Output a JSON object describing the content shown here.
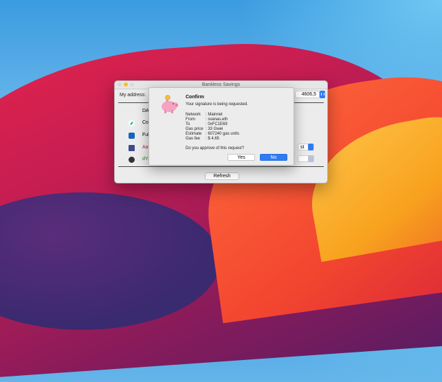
{
  "window": {
    "title": "Bankless Savings",
    "address_label": "My address:",
    "balance": "4606,5",
    "refresh_label": "Refresh"
  },
  "rows": [
    {
      "name": "DAI",
      "color": "#222222"
    },
    {
      "name": "Compound",
      "color": "#222222",
      "icon": "compound-icon"
    },
    {
      "name": "Fulcrum",
      "color": "#222222",
      "icon": "fulcrum-icon"
    },
    {
      "name": "Aave",
      "color": "#b0203f",
      "icon": "aave-icon"
    },
    {
      "name": "dYdX",
      "color": "#1f7d2a",
      "icon": "dydx-icon"
    }
  ],
  "select_visible": "st",
  "dialog": {
    "title": "Confirm",
    "message": "Your signature is being requested.",
    "details": [
      {
        "key": "Network",
        "value": ": Mainnet"
      },
      {
        "key": "From",
        "value": ": svanas.eth"
      },
      {
        "key": "To",
        "value": ": 0xFC1E69"
      },
      {
        "key": "Gas price",
        "value": ": 33 Gwei"
      },
      {
        "key": "Estimate",
        "value": ": 607240 gas units"
      },
      {
        "key": "Gas fee",
        "value": ": $ 4,65"
      }
    ],
    "question": "Do you approve of this request?",
    "yes_label": "Yes",
    "no_label": "No"
  },
  "colors": {
    "accent": "#2f7bf5"
  }
}
